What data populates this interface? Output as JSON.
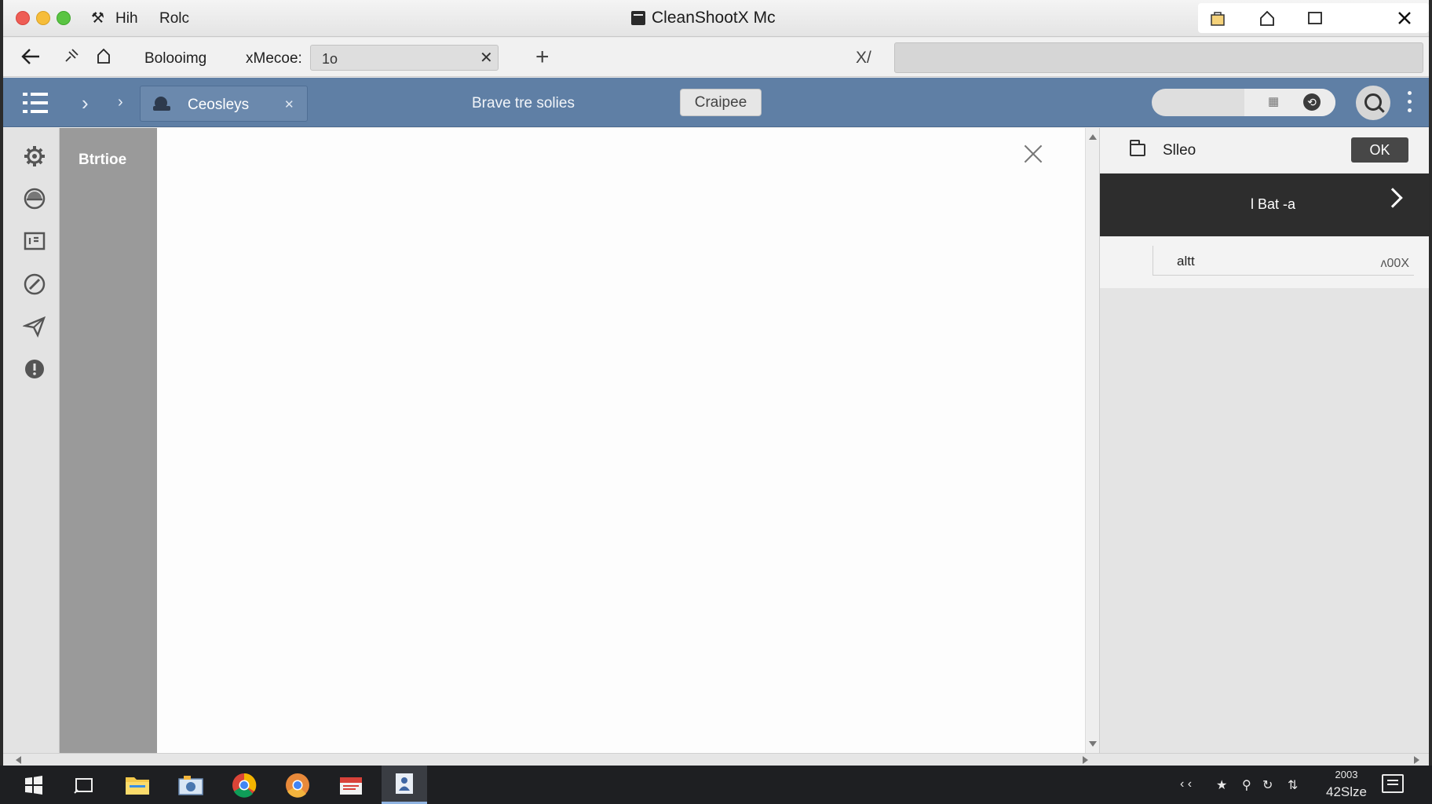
{
  "window": {
    "title": "CleanShootX Mc"
  },
  "menu": {
    "item1": "Hih",
    "item2": "Rolc"
  },
  "nav": {
    "tab_label": "Bolooimg",
    "field_label": "xMecoe:",
    "field_value": "1o",
    "xy_label": "X/"
  },
  "toolbar": {
    "crumb_label": "Ceosleys",
    "center_text": "Brave tre solies",
    "button_label": "Craipee"
  },
  "sidebar": {
    "title": "Btrtioe"
  },
  "right_panel": {
    "title": "Slleo",
    "ok_label": "OK",
    "dark_label": "l Bat -a",
    "field_label": "altt",
    "field_value": "ʌ00X"
  },
  "taskbar": {
    "clock_top": "2003",
    "clock_bottom": "42Slze"
  },
  "colors": {
    "toolbar_bg": "#5f7fa5",
    "sidebar_bg": "#9a9a9a",
    "panel_dark": "#2d2d2d"
  }
}
